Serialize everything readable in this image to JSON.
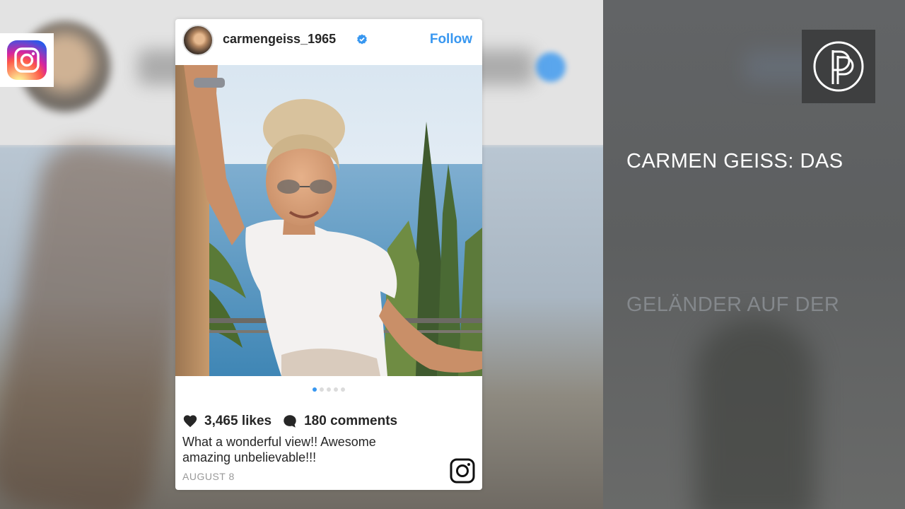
{
  "post": {
    "username": "carmengeiss_1965",
    "verified": true,
    "follow_label": "Follow",
    "likes": "3,465 likes",
    "comments": "180 comments",
    "caption": "What a wonderful view!! Awesome amazing unbelievable!!!",
    "date": "AUGUST 8",
    "carousel": {
      "total": 5,
      "active_index": 0
    }
  },
  "overlay": {
    "headline": "CARMEN GEISS: DAS",
    "subline": "GELÄNDER AUF DER"
  },
  "colors": {
    "accent_blue": "#3897f0",
    "headline_text": "#ffffff",
    "subline_text": "#84888c",
    "right_panel": "#5f6162"
  },
  "icons": {
    "top_left_logo": "instagram-logo-icon",
    "top_right_logo": "double-p-logo-icon",
    "verified": "verified-badge-icon",
    "likes": "heart-icon",
    "comments": "comment-bubble-icon",
    "card_corner": "instagram-outline-icon"
  }
}
